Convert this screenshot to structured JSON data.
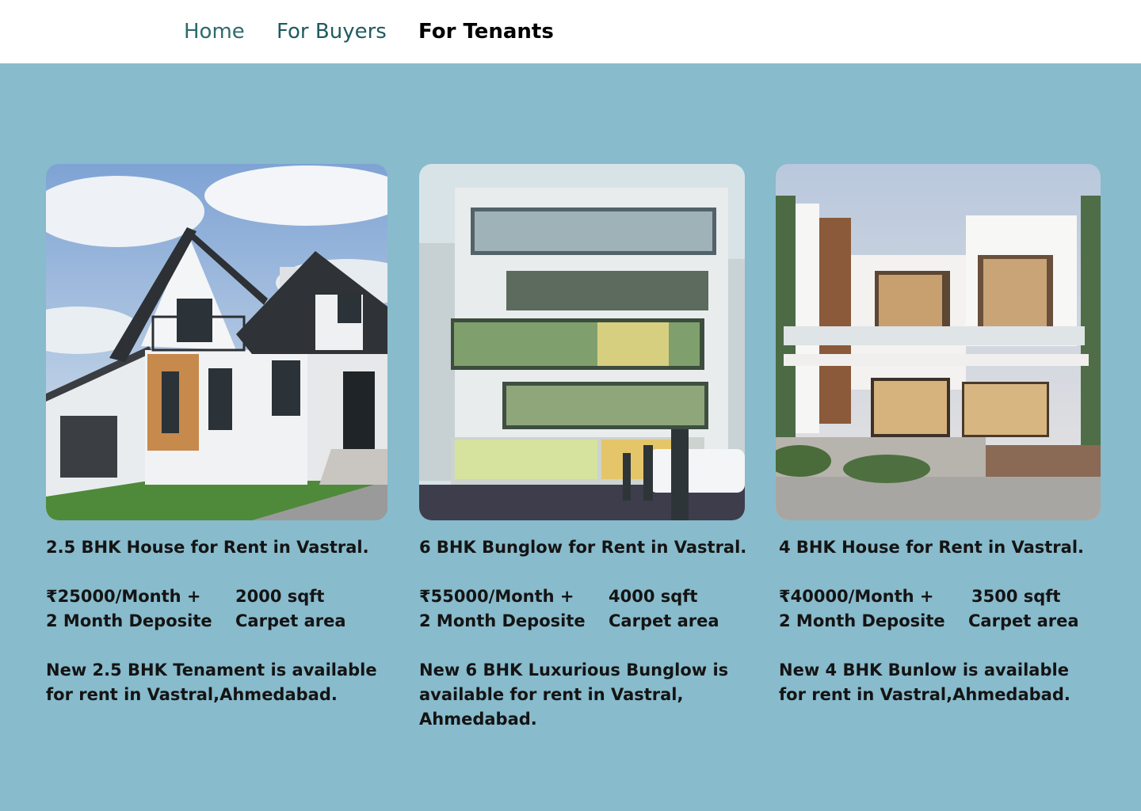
{
  "nav": {
    "home": "Home",
    "buyers": "For Buyers",
    "tenants": "For Tenants"
  },
  "cards": [
    {
      "title": "2.5 BHK House for Rent in Vastral.",
      "price": "₹25000/Month +",
      "deposit": "2 Month Deposite",
      "area": "2000 sqft",
      "area_label": "Carpet area",
      "description": "New 2.5 BHK Tenament is available for rent in Vastral,Ahmedabad.",
      "image": "house-photo"
    },
    {
      "title": "6 BHK Bunglow for Rent in Vastral.",
      "price": "₹55000/Month +",
      "deposit": "2 Month Deposite",
      "area": "4000 sqft",
      "area_label": "Carpet area",
      "description": "New 6 BHK Luxurious Bunglow is available for rent in Vastral, Ahmedabad.",
      "image": "bungalow-photo"
    },
    {
      "title": "4 BHK House for Rent in Vastral.",
      "price": "₹40000/Month +",
      "deposit": "2 Month Deposite",
      "area": "3500 sqft",
      "area_label": "Carpet area",
      "description": "New 4 BHK Bunlow is available for rent in Vastral,Ahmedabad.",
      "image": "villa-photo"
    }
  ],
  "colors": {
    "background": "#88bbcc",
    "header": "#ffffff",
    "nav_link": "#2f6a6e",
    "nav_active": "#000000"
  }
}
